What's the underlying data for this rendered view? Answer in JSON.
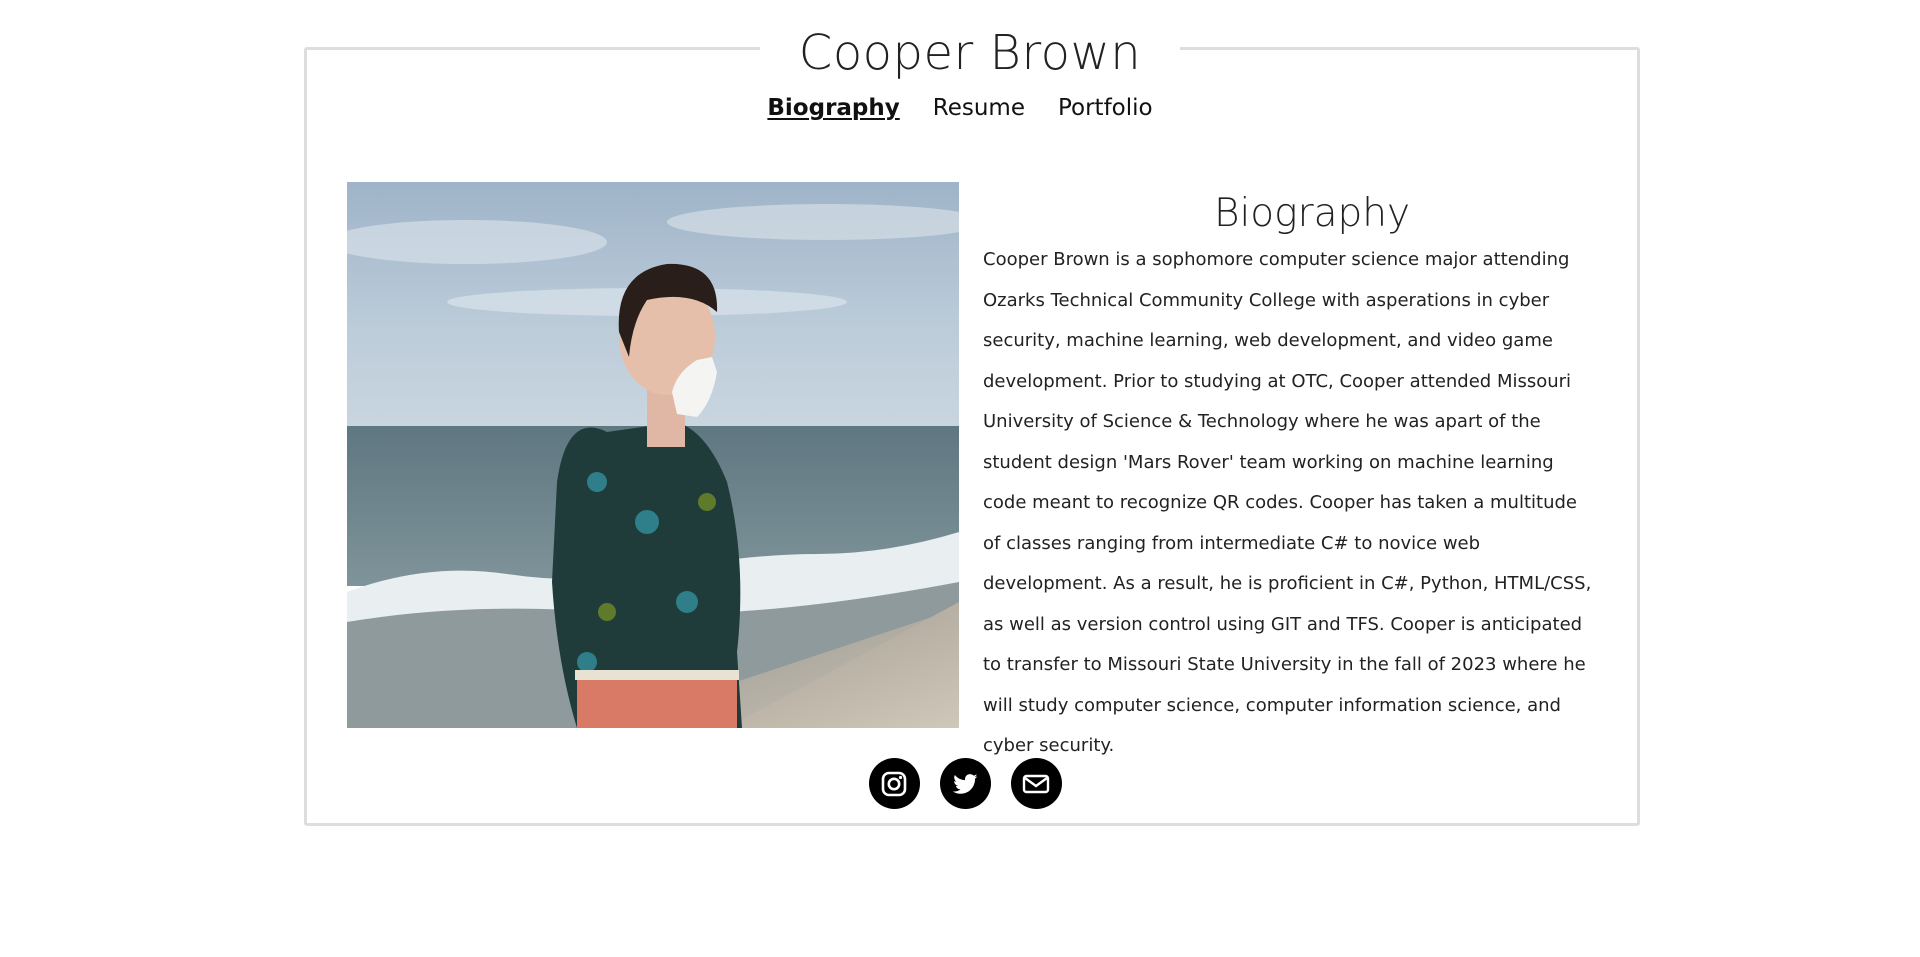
{
  "site": {
    "title": "Cooper Brown"
  },
  "nav": {
    "items": [
      {
        "label": "Biography",
        "active": true
      },
      {
        "label": "Resume",
        "active": false
      },
      {
        "label": "Portfolio",
        "active": false
      }
    ]
  },
  "main": {
    "heading": "Biography",
    "paragraph": "Cooper Brown is a sophomore computer science major attending Ozarks Technical Community College with asperations in cyber security, machine learning, web development, and video game development. Prior to studying at OTC, Cooper attended Missouri University of Science & Technology where he was apart of the student design 'Mars Rover' team working on machine learning code meant to recognize QR codes. Cooper has taken a multitude of classes ranging from intermediate C# to novice web development. As a result, he is proficient in C#, Python, HTML/CSS, as well as version control using GIT and TFS. Cooper is anticipated to transfer to Missouri State University in the fall of 2023 where he will study computer science, computer information science, and cyber security."
  },
  "social": {
    "icons": [
      "instagram-icon",
      "twitter-icon",
      "mail-icon"
    ]
  },
  "colors": {
    "border": "#dddddd",
    "text": "#222222",
    "icon_bg": "#000000"
  }
}
